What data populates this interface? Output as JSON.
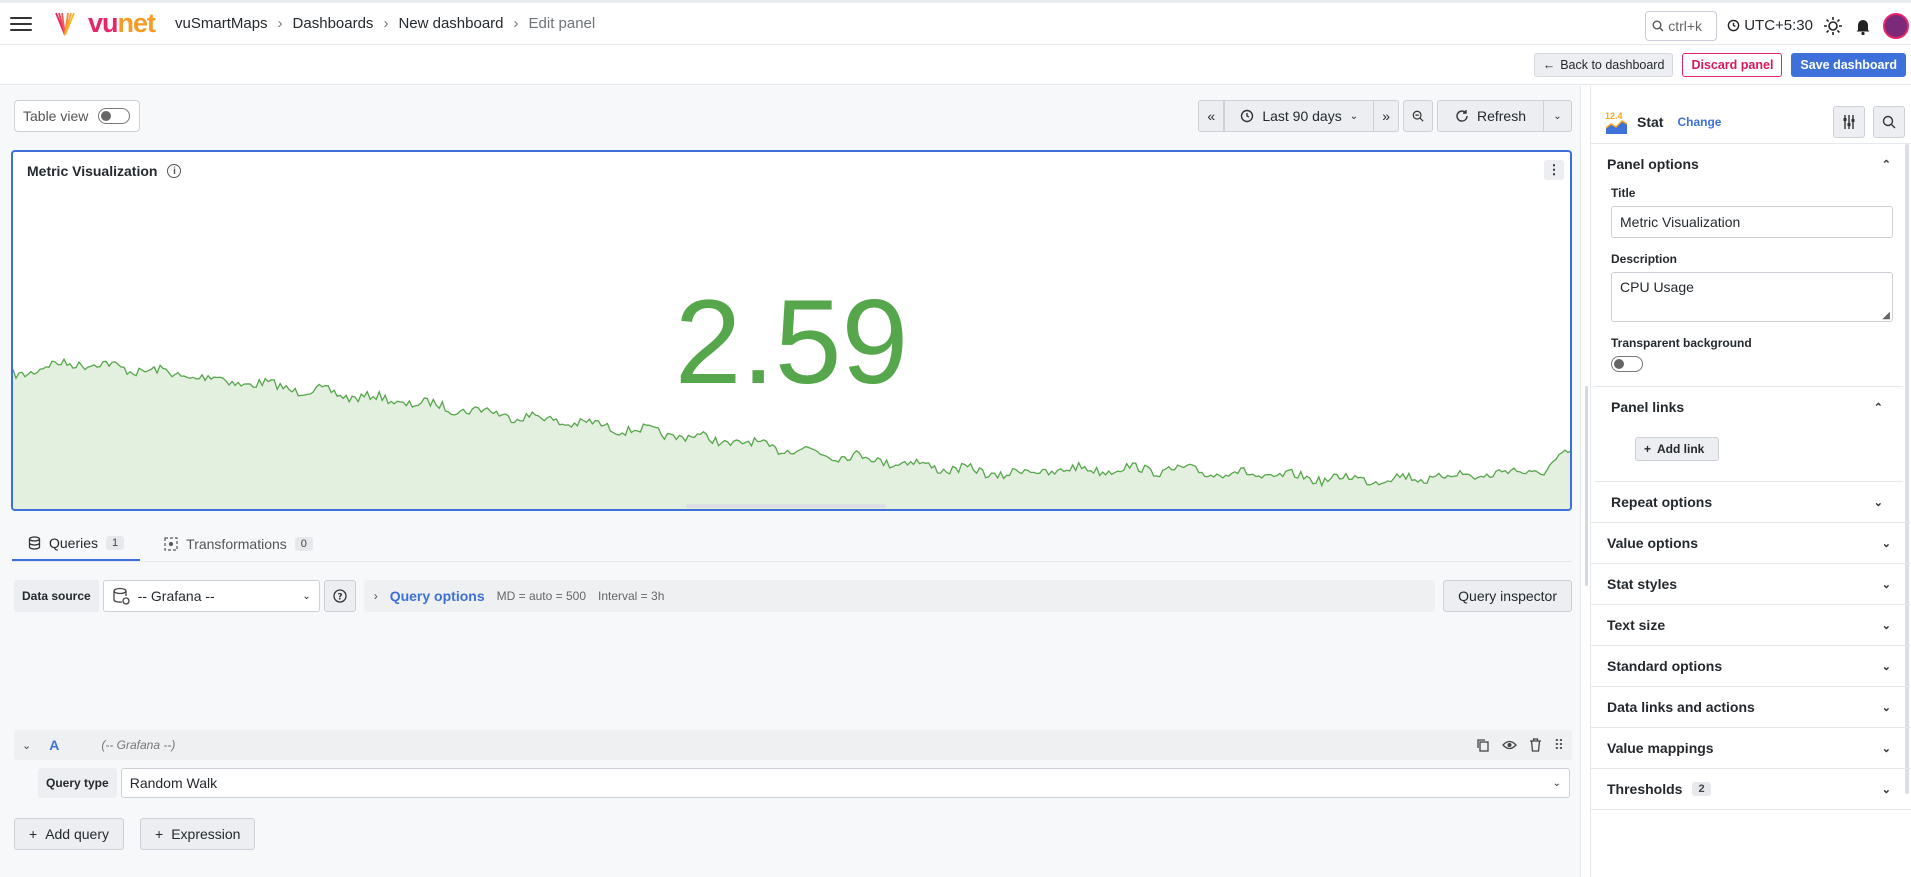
{
  "header": {
    "breadcrumb": [
      "vuSmartMaps",
      "Dashboards",
      "New dashboard",
      "Edit panel"
    ],
    "search_hint": "ctrl+k",
    "timezone": "UTC+5:30",
    "logo": "vunet"
  },
  "actions": {
    "back": "Back to dashboard",
    "discard": "Discard panel",
    "save": "Save dashboard"
  },
  "toolbar": {
    "table_view": "Table view",
    "time_range": "Last 90 days",
    "refresh": "Refresh"
  },
  "panel": {
    "title": "Metric Visualization",
    "value": "2.59",
    "value_color": "#56a64b"
  },
  "query_tabs": [
    {
      "label": "Queries",
      "count": "1"
    },
    {
      "label": "Transformations",
      "count": "0"
    }
  ],
  "query_bar": {
    "ds_label": "Data source",
    "ds_value": "-- Grafana --",
    "options_label": "Query options",
    "md": "MD = auto = 500",
    "interval": "Interval = 3h",
    "inspector": "Query inspector"
  },
  "query": {
    "letter": "A",
    "ds": "(-- Grafana --)",
    "type_label": "Query type",
    "type_value": "Random Walk"
  },
  "add": {
    "query": "Add query",
    "expression": "Expression"
  },
  "viz": {
    "icon_number": "12.4",
    "name": "Stat",
    "change": "Change"
  },
  "options": {
    "panel_options": "Panel options",
    "title_label": "Title",
    "title_value": "Metric Visualization",
    "desc_label": "Description",
    "desc_value": "CPU Usage",
    "transparent_label": "Transparent background",
    "panel_links": "Panel links",
    "add_link": "Add link",
    "repeat": "Repeat options",
    "sections": [
      {
        "label": "Value options"
      },
      {
        "label": "Stat styles"
      },
      {
        "label": "Text size"
      },
      {
        "label": "Standard options"
      },
      {
        "label": "Data links and actions"
      },
      {
        "label": "Value mappings"
      },
      {
        "label": "Thresholds",
        "count": "2"
      }
    ]
  }
}
